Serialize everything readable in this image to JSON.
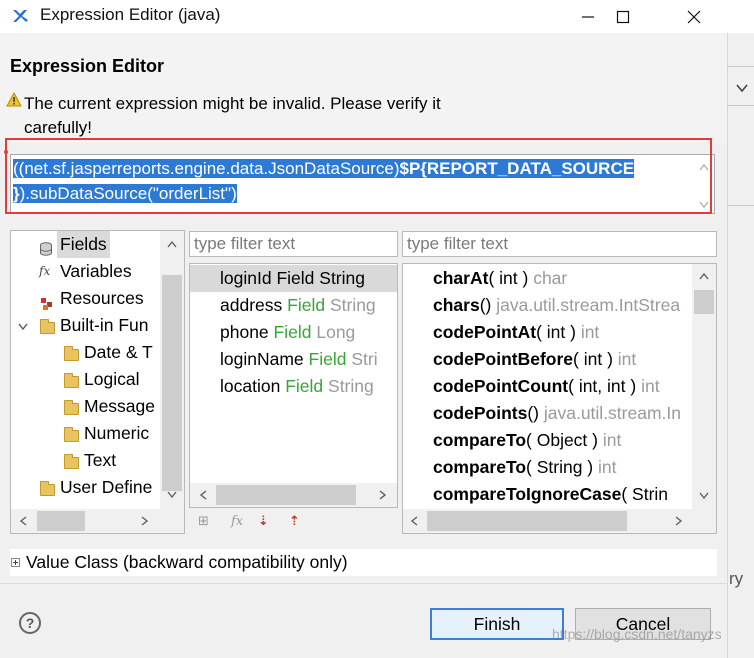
{
  "window": {
    "title": "Expression Editor (java)"
  },
  "header": {
    "title": "Expression Editor",
    "warning_line1": "The current expression might be invalid. Please verify it",
    "warning_line2": "carefully!"
  },
  "expression": {
    "line1_normal": "((net.sf.jasperreports.engine.data.JsonDataSource)",
    "line1_bold": "$P{REPORT_DATA_SOURCE",
    "line2_bold": "}",
    "line2_normal": ").subDataSource(\"orderList\")"
  },
  "categories": {
    "items": [
      {
        "label": "Fields",
        "icon": "fields-icon"
      },
      {
        "label": "Variables",
        "icon": "fx-icon"
      },
      {
        "label": "Resources",
        "icon": "resources-icon"
      },
      {
        "label": "Built-in Fun",
        "icon": "folder-icon"
      },
      {
        "label": "Date & T",
        "icon": "folder-icon"
      },
      {
        "label": "Logical",
        "icon": "folder-icon"
      },
      {
        "label": "Message",
        "icon": "folder-icon"
      },
      {
        "label": "Numeric",
        "icon": "folder-icon"
      },
      {
        "label": "Text",
        "icon": "folder-icon"
      },
      {
        "label": "User Define",
        "icon": "folder-icon"
      }
    ]
  },
  "fields": {
    "filter_placeholder": "type filter text",
    "items": [
      {
        "name": "loginId",
        "kind": "Field",
        "type": "String"
      },
      {
        "name": "address",
        "kind": "Field",
        "type": "String"
      },
      {
        "name": "phone",
        "kind": "Field",
        "type": "Long"
      },
      {
        "name": "loginName",
        "kind": "Field",
        "type": "Stri"
      },
      {
        "name": "location",
        "kind": "Field",
        "type": "String"
      }
    ]
  },
  "methods": {
    "filter_placeholder": "type filter text",
    "items": [
      {
        "name": "charAt",
        "params": "( int )",
        "ret": "char"
      },
      {
        "name": "chars",
        "params": "()",
        "ret": "java.util.stream.IntStrea"
      },
      {
        "name": "codePointAt",
        "params": "( int )",
        "ret": "int"
      },
      {
        "name": "codePointBefore",
        "params": "( int )",
        "ret": "int"
      },
      {
        "name": "codePointCount",
        "params": "( int, int )",
        "ret": "int"
      },
      {
        "name": "codePoints",
        "params": "()",
        "ret": "java.util.stream.In"
      },
      {
        "name": "compareTo",
        "params": "( Object )",
        "ret": "int"
      },
      {
        "name": "compareTo",
        "params": "( String )",
        "ret": "int"
      },
      {
        "name": "compareToIgnoreCase",
        "params": "( Strin",
        "ret": ""
      }
    ]
  },
  "value_class": {
    "label": "Value Class (backward compatibility only)"
  },
  "buttons": {
    "finish": "Finish",
    "cancel": "Cancel",
    "help": "?"
  },
  "watermark": "https://blog.csdn.net/tanyzs",
  "right_strip": {
    "text": "ry"
  },
  "colors": {
    "selection": "#2c7ad6",
    "field_kind": "#3aa43a",
    "type_gray": "#9a9a9a",
    "frame_red": "#e23b3b"
  }
}
